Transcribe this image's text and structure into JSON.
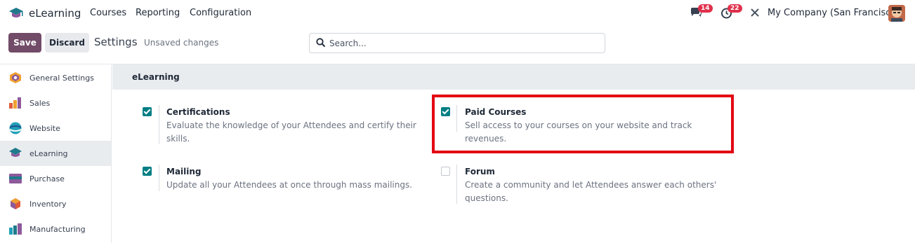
{
  "navbar": {
    "app_name": "eLearning",
    "menu": [
      "Courses",
      "Reporting",
      "Configuration"
    ],
    "messages_count": "14",
    "activities_count": "22",
    "company": "My Company (San Francisco)"
  },
  "control_panel": {
    "save_label": "Save",
    "discard_label": "Discard",
    "title": "Settings",
    "status": "Unsaved changes",
    "search_placeholder": "Search..."
  },
  "sidebar": {
    "items": [
      {
        "label": "General Settings",
        "icon": "general-settings-icon"
      },
      {
        "label": "Sales",
        "icon": "sales-icon"
      },
      {
        "label": "Website",
        "icon": "website-icon"
      },
      {
        "label": "eLearning",
        "icon": "elearning-icon",
        "active": true
      },
      {
        "label": "Purchase",
        "icon": "purchase-icon"
      },
      {
        "label": "Inventory",
        "icon": "inventory-icon"
      },
      {
        "label": "Manufacturing",
        "icon": "manufacturing-icon"
      }
    ]
  },
  "section": {
    "title": "eLearning",
    "settings": [
      {
        "title": "Certifications",
        "desc": "Evaluate the knowledge of your Attendees and certify their skills.",
        "checked": true
      },
      {
        "title": "Paid Courses",
        "desc": "Sell access to your courses on your website and track revenues.",
        "checked": true
      },
      {
        "title": "Mailing",
        "desc": "Update all your Attendees at once through mass mailings.",
        "checked": true
      },
      {
        "title": "Forum",
        "desc": "Create a community and let Attendees answer each others' questions.",
        "checked": false
      }
    ]
  },
  "colors": {
    "brand": "#714B67",
    "checkbox": "#017e84",
    "badge": "#e0304b",
    "highlight": "#e30613"
  }
}
